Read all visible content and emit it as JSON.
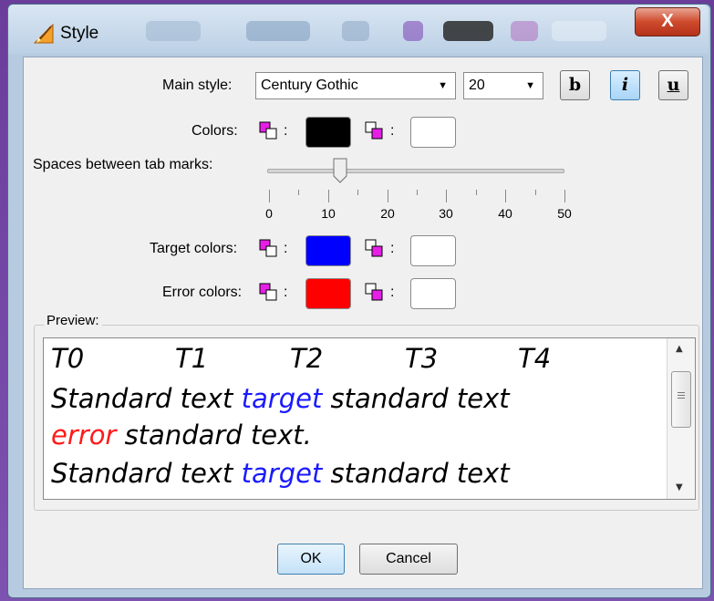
{
  "window": {
    "title": "Style",
    "close_glyph": "X"
  },
  "main_style": {
    "label": "Main style:",
    "font_value": "Century Gothic",
    "size_value": "20",
    "bold_label": "b",
    "italic_label": "i",
    "underline_label": "u",
    "italic_active": true
  },
  "colors": {
    "label": "Colors:",
    "colon": ":",
    "foreground": "#000000",
    "background": "#ffffff"
  },
  "tab_marks": {
    "label": "Spaces between tab marks:",
    "value": 12,
    "min": 0,
    "max": 50,
    "tick_labels": [
      "0",
      "10",
      "20",
      "30",
      "40",
      "50"
    ]
  },
  "target_colors": {
    "label": "Target colors:",
    "foreground": "#0000ff",
    "background": "#ffffff"
  },
  "error_colors": {
    "label": "Error colors:",
    "foreground": "#ff0000",
    "background": "#ffffff"
  },
  "preview": {
    "label": "Preview:",
    "tabs": [
      "T0",
      "T1",
      "T2",
      "T3",
      "T4"
    ],
    "line2_a": "Standard text ",
    "line2_target": "target",
    "line2_b": " standard text",
    "line3_error": "error",
    "line3_b": " standard text.",
    "line4_a": "Standard text ",
    "line4_target": "target",
    "line4_b": " standard text"
  },
  "buttons": {
    "ok": "OK",
    "cancel": "Cancel"
  },
  "theme": {
    "target_text": "#1a1aff",
    "error_text": "#ff1a1a",
    "swatch_icon_color": "#e61ee6"
  }
}
